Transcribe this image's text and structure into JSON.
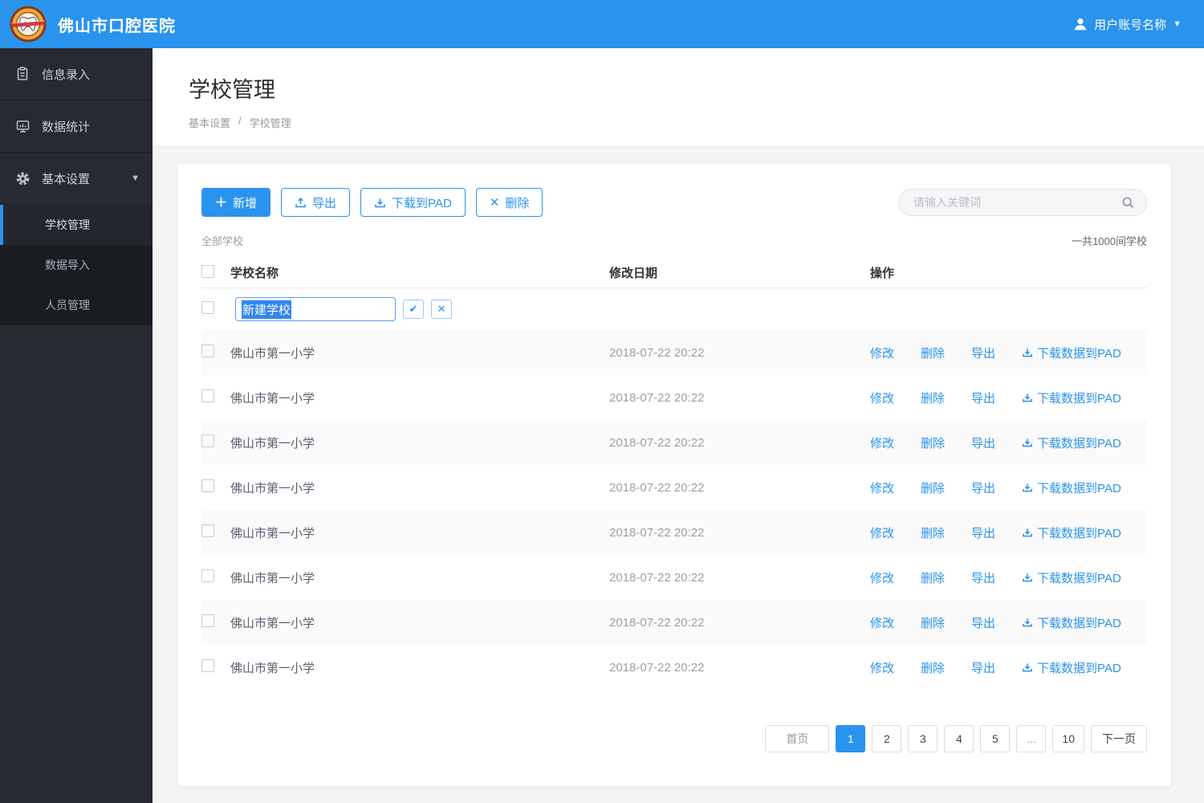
{
  "colors": {
    "accent": "#2a93ee",
    "sidebar_bg": "#272a31",
    "submenu_bg": "#191c21",
    "stripe": "#fafafa"
  },
  "topbar": {
    "brand": "佛山市口腔医院",
    "user": "用户账号名称"
  },
  "sidebar": {
    "items": [
      {
        "label": "信息录入",
        "icon": "clipboard-icon"
      },
      {
        "label": "数据统计",
        "icon": "chart-icon"
      },
      {
        "label": "基本设置",
        "icon": "gear-icon",
        "expanded": true
      }
    ],
    "subitems": [
      {
        "label": "学校管理",
        "active": true
      },
      {
        "label": "数据导入"
      },
      {
        "label": "人员管理"
      }
    ]
  },
  "page": {
    "title": "学校管理",
    "breadcrumb_1": "基本设置",
    "breadcrumb_sep": "/",
    "breadcrumb_2": "学校管理"
  },
  "toolbar": {
    "add": "新增",
    "export": "导出",
    "download_pad": "下载到PAD",
    "delete": "删除"
  },
  "search": {
    "placeholder": "请输入关键词"
  },
  "summary": {
    "filter_label": "全部学校",
    "total_label": "一共1000间学校"
  },
  "table": {
    "columns": {
      "name": "学校名称",
      "date": "修改日期",
      "ops": "操作"
    },
    "edit_row": {
      "value": "新建学校"
    },
    "row_actions": {
      "edit": "修改",
      "delete": "删除",
      "export": "导出",
      "download": "下载数据到PAD"
    },
    "rows": [
      {
        "name": "佛山市第一小学",
        "date": "2018-07-22 20:22"
      },
      {
        "name": "佛山市第一小学",
        "date": "2018-07-22 20:22"
      },
      {
        "name": "佛山市第一小学",
        "date": "2018-07-22 20:22"
      },
      {
        "name": "佛山市第一小学",
        "date": "2018-07-22 20:22"
      },
      {
        "name": "佛山市第一小学",
        "date": "2018-07-22 20:22"
      },
      {
        "name": "佛山市第一小学",
        "date": "2018-07-22 20:22"
      },
      {
        "name": "佛山市第一小学",
        "date": "2018-07-22 20:22"
      },
      {
        "name": "佛山市第一小学",
        "date": "2018-07-22 20:22"
      }
    ]
  },
  "pagination": {
    "items": [
      {
        "label": "首页",
        "kind": "first"
      },
      {
        "label": "1",
        "kind": "page",
        "active": true
      },
      {
        "label": "2",
        "kind": "page"
      },
      {
        "label": "3",
        "kind": "page"
      },
      {
        "label": "4",
        "kind": "page"
      },
      {
        "label": "5",
        "kind": "page"
      },
      {
        "label": "...",
        "kind": "ellipsis"
      },
      {
        "label": "10",
        "kind": "page"
      },
      {
        "label": "下一页",
        "kind": "next"
      }
    ]
  }
}
